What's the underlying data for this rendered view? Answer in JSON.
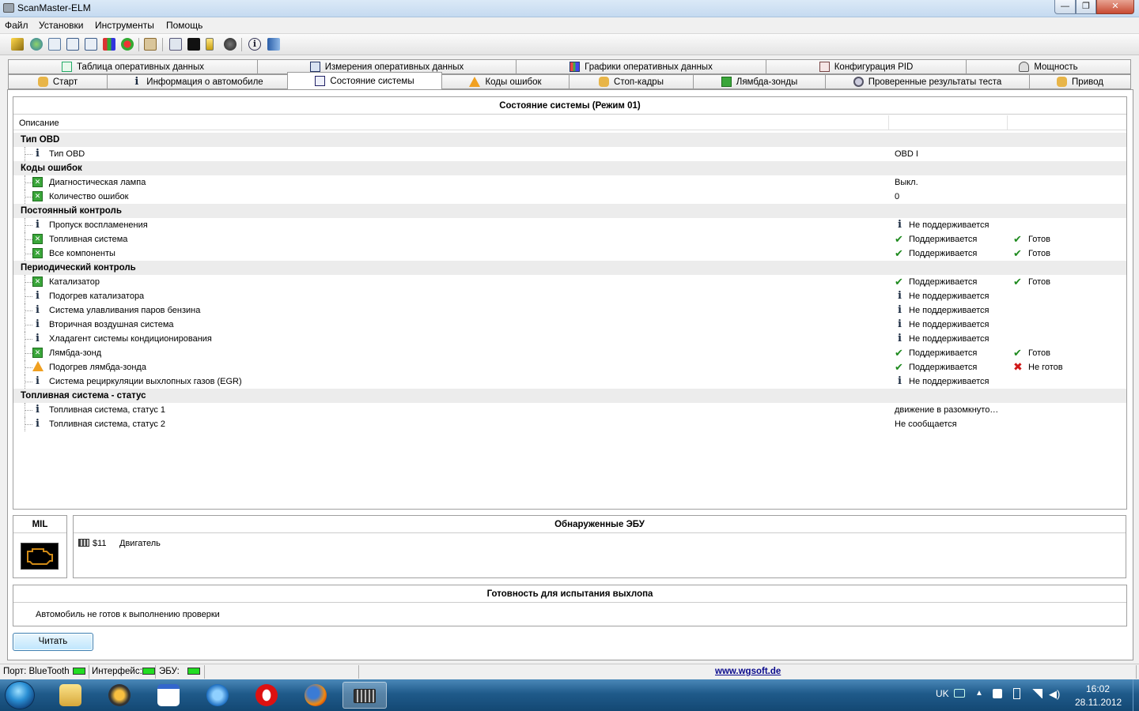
{
  "window": {
    "title": "ScanMaster-ELM",
    "minimize": "—",
    "maximize": "❐",
    "close": "✕"
  },
  "menu": [
    "Файл",
    "Установки",
    "Инструменты",
    "Помощь"
  ],
  "tabs_row1": [
    {
      "label": "Таблица оперативных данных",
      "icon": "table-icon"
    },
    {
      "label": "Измерения оперативных данных",
      "icon": "grid-icon"
    },
    {
      "label": "Графики оперативных данных",
      "icon": "chart-icon"
    },
    {
      "label": "Конфигурация PID",
      "icon": "document-icon"
    },
    {
      "label": "Мощность",
      "icon": "gauge-icon"
    }
  ],
  "tabs_row2": [
    {
      "label": "Старт",
      "icon": "hand-icon"
    },
    {
      "label": "Информация о автомобиле",
      "icon": "info-icon"
    },
    {
      "label": "Состояние системы",
      "icon": "checklist-icon",
      "active": true
    },
    {
      "label": "Коды ошибок",
      "icon": "warning-icon"
    },
    {
      "label": "Стоп-кадры",
      "icon": "hand-icon"
    },
    {
      "label": "Лямбда-зонды",
      "icon": "green-box-icon"
    },
    {
      "label": "Проверенные результаты теста",
      "icon": "gear-icon"
    },
    {
      "label": "Привод",
      "icon": "hand-icon"
    }
  ],
  "status_panel": {
    "title": "Состояние системы (Режим 01)",
    "column_description": "Описание",
    "rows": [
      {
        "type": "group",
        "label": "Тип OBD"
      },
      {
        "type": "item",
        "icon": "info",
        "label": "Тип OBD",
        "v1": "OBD I"
      },
      {
        "type": "group",
        "label": "Коды ошибок"
      },
      {
        "type": "item",
        "icon": "green",
        "label": "Диагностическая лампа",
        "v1": "Выкл."
      },
      {
        "type": "item",
        "icon": "green",
        "label": "Количество ошибок",
        "v1": "0"
      },
      {
        "type": "group",
        "label": "Постоянный контроль"
      },
      {
        "type": "item",
        "icon": "info",
        "label": "Пропуск воспламенения",
        "v1_icon": "info",
        "v1": "Не поддерживается"
      },
      {
        "type": "item",
        "icon": "green",
        "label": "Топливная система",
        "v1_icon": "check",
        "v1": "Поддерживается",
        "v2_icon": "check",
        "v2": "Готов"
      },
      {
        "type": "item",
        "icon": "green",
        "label": "Все компоненты",
        "v1_icon": "check",
        "v1": "Поддерживается",
        "v2_icon": "check",
        "v2": "Готов"
      },
      {
        "type": "group",
        "label": "Периодический контроль"
      },
      {
        "type": "item",
        "icon": "green",
        "label": "Катализатор",
        "v1_icon": "check",
        "v1": "Поддерживается",
        "v2_icon": "check",
        "v2": "Готов"
      },
      {
        "type": "item",
        "icon": "info",
        "label": "Подогрев катализатора",
        "v1_icon": "info",
        "v1": "Не поддерживается"
      },
      {
        "type": "item",
        "icon": "info",
        "label": "Система улавливания паров бензина",
        "v1_icon": "info",
        "v1": "Не поддерживается"
      },
      {
        "type": "item",
        "icon": "info",
        "label": "Вторичная воздушная система",
        "v1_icon": "info",
        "v1": "Не поддерживается"
      },
      {
        "type": "item",
        "icon": "info",
        "label": "Хладагент системы кондиционирования",
        "v1_icon": "info",
        "v1": "Не поддерживается"
      },
      {
        "type": "item",
        "icon": "green",
        "label": "Лямбда-зонд",
        "v1_icon": "check",
        "v1": "Поддерживается",
        "v2_icon": "check",
        "v2": "Готов"
      },
      {
        "type": "item",
        "icon": "warn",
        "label": "Подогрев лямбда-зонда",
        "v1_icon": "check",
        "v1": "Поддерживается",
        "v2_icon": "cross",
        "v2": "Не готов"
      },
      {
        "type": "item",
        "icon": "info",
        "label": "Система рециркуляции выхлопных газов (EGR)",
        "v1_icon": "info",
        "v1": "Не поддерживается"
      },
      {
        "type": "group",
        "label": "Топливная система - статус"
      },
      {
        "type": "item",
        "icon": "info",
        "label": "Топливная система, статус 1",
        "v1": "движение в разомкнуто…"
      },
      {
        "type": "item",
        "icon": "info",
        "label": "Топливная система, статус 2",
        "v1": "Не сообщается"
      }
    ]
  },
  "mil_panel": {
    "title": "MIL",
    "icon": "engine-icon"
  },
  "ecu_panel": {
    "title": "Обнаруженные ЭБУ",
    "items": [
      {
        "id": "$11",
        "name": "Двигатель",
        "icon": "chip-icon"
      }
    ]
  },
  "emission_panel": {
    "title": "Готовность для испытания выхлопа",
    "text": "Автомобиль не готов к выполнению проверки"
  },
  "read_button": "Читать",
  "statusbar": {
    "port": "Порт: BlueTooth",
    "interface": "Интерфейс:",
    "ecu": "ЭБУ:",
    "url": "www.wgsoft.de"
  },
  "taskbar": {
    "apps": [
      "explorer-icon",
      "aimp-icon",
      "calendar-icon",
      "internet-explorer-icon",
      "opera-icon",
      "firefox-icon",
      "scanmaster-icon"
    ],
    "lang": "UK",
    "time": "16:02",
    "date": "28.11.2012"
  },
  "colors": {
    "accent": "#3aa63a",
    "error": "#d01818",
    "warning": "#f0a020",
    "link": "#0a0a8c"
  }
}
